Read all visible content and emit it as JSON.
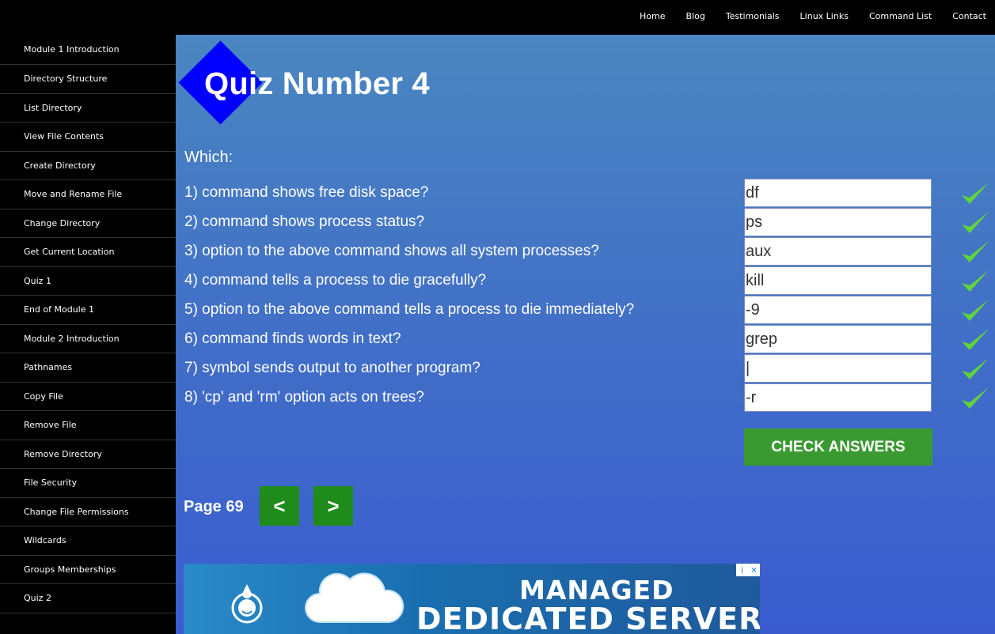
{
  "top_nav": [
    "Home",
    "Blog",
    "Testimonials",
    "Linux Links",
    "Command List",
    "Contact"
  ],
  "sidebar": [
    "Module 1 Introduction",
    "Directory Structure",
    "List Directory",
    "View File Contents",
    "Create Directory",
    "Move and Rename File",
    "Change Directory",
    "Get Current Location",
    "Quiz 1",
    "End of Module 1",
    "Module 2 Introduction",
    "Pathnames",
    "Copy File",
    "Remove File",
    "Remove Directory",
    "File Security",
    "Change File Permissions",
    "Wildcards",
    "Groups Memberships",
    "Quiz 2"
  ],
  "quiz": {
    "title": "Quiz Number 4",
    "intro": "Which:",
    "questions": [
      {
        "text": "1) command shows free disk space?",
        "answer": "df"
      },
      {
        "text": "2) command shows process status?",
        "answer": "ps"
      },
      {
        "text": "3) option to the above command shows all system processes?",
        "answer": "aux"
      },
      {
        "text": "4) command tells a process to die gracefully?",
        "answer": "kill"
      },
      {
        "text": "5) option to the above command tells a process to die immediately?",
        "answer": "-9"
      },
      {
        "text": "6) command finds words in text?",
        "answer": "grep"
      },
      {
        "text": "7) symbol sends output to another program?",
        "answer": "|"
      },
      {
        "text": "8) 'cp' and 'rm' option acts on trees?",
        "answer": "-r"
      }
    ],
    "check_label": "CHECK ANSWERS"
  },
  "pager": {
    "page_label": "Page 69",
    "prev_label": "<",
    "next_label": ">"
  },
  "ad": {
    "line1": "MANAGED",
    "line2": "DEDICATED SERVERS",
    "info_icon": "i",
    "close_icon": "✕"
  },
  "colors": {
    "check_green": "#3a9a31",
    "nav_green": "#1f8b1a",
    "diamond_blue": "#0000ff",
    "checkmark": "#5fd53a"
  }
}
